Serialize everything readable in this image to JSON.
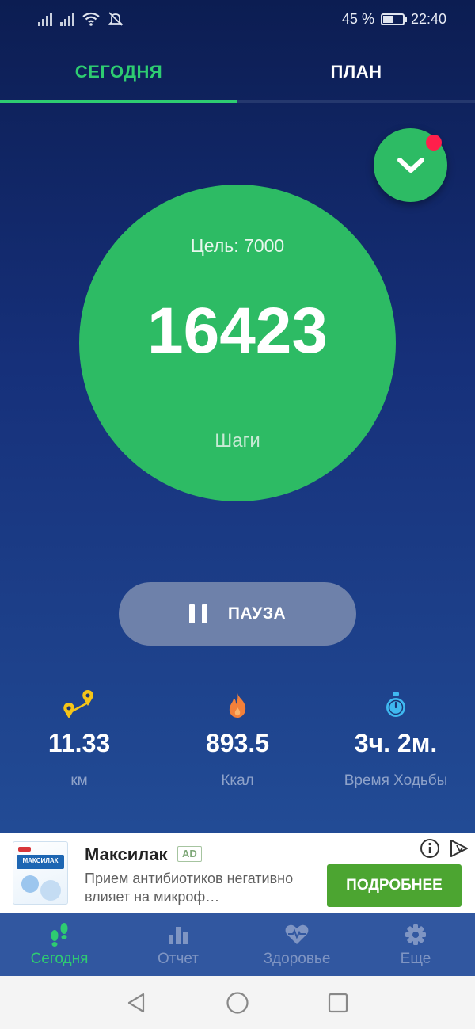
{
  "status_bar": {
    "battery_percent": "45 %",
    "battery_level": 0.45,
    "time": "22:40",
    "icons": [
      "signal-icon",
      "signal-icon",
      "wifi-icon",
      "bell-off-icon",
      "battery-icon"
    ]
  },
  "tabs": [
    {
      "label": "СЕГОДНЯ",
      "active": true
    },
    {
      "label": "ПЛАН",
      "active": false
    }
  ],
  "dropdown": {
    "icon": "chevron-down-icon",
    "has_notification": true
  },
  "steps": {
    "goal_text": "Цель: 7000",
    "count": "16423",
    "label": "Шаги"
  },
  "pause_button": {
    "label": "ПАУЗА",
    "icon": "pause-icon"
  },
  "stats": [
    {
      "icon": "route-pin-icon",
      "value": "11.33",
      "label": "км"
    },
    {
      "icon": "flame-icon",
      "value": "893.5",
      "label": "Ккал"
    },
    {
      "icon": "stopwatch-icon",
      "value": "3ч. 2м.",
      "label": "Время Ходьбы"
    }
  ],
  "ad": {
    "title": "Максилак",
    "badge": "AD",
    "description": "Прием антибиотиков негативно влияет на микроф…",
    "cta": "ПОДРОБНЕЕ",
    "image_text": "МАКСИЛАК"
  },
  "bottom_nav": [
    {
      "label": "Сегодня",
      "icon": "footprints-icon",
      "active": true
    },
    {
      "label": "Отчет",
      "icon": "bar-chart-icon",
      "active": false
    },
    {
      "label": "Здоровье",
      "icon": "heart-pulse-icon",
      "active": false
    },
    {
      "label": "Еще",
      "icon": "gear-icon",
      "active": false
    }
  ],
  "colors": {
    "accent": "#2dbb64",
    "background_top": "#0c1d52",
    "background_bottom": "#24509a",
    "notification_dot": "#ff1f4b",
    "cta_green": "#4ca531",
    "nav_background": "#3157a0"
  }
}
